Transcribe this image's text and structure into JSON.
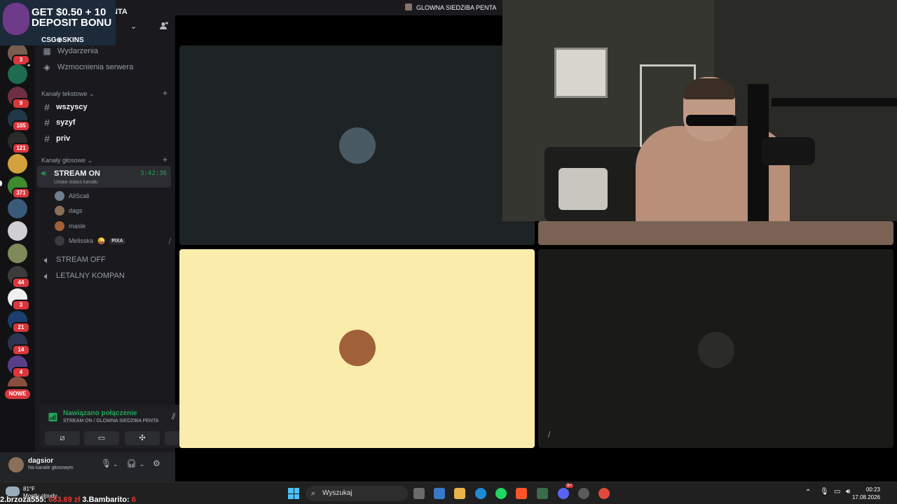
{
  "promo": {
    "headline_line1": "GET $0.50 + 10",
    "headline_line2": "DEPOSIT BONU",
    "brand": "CSG⊕SKINS"
  },
  "server": {
    "name_partial": "NTA"
  },
  "server_rail": {
    "badges": [
      "3",
      "9",
      "105",
      "121",
      "371",
      "44",
      "3",
      "21",
      "14",
      "4"
    ],
    "nowe_label": "NOWE"
  },
  "sidebar": {
    "menu": [
      {
        "label": "Wydarzenia",
        "icon": "calendar-icon"
      },
      {
        "label": "Wzmocnienia serwera",
        "icon": "boost-icon"
      }
    ],
    "text_category": "Kanały tekstowe",
    "text_channels": [
      "wszyscy",
      "syzyf",
      "priv"
    ],
    "voice_category": "Kanały głosowe",
    "active_voice": {
      "name": "STREAM ON",
      "timer": "3:42:36",
      "status": "Ustaw status kanału"
    },
    "members": [
      {
        "name": "AliScali"
      },
      {
        "name": "dags"
      },
      {
        "name": "masle"
      },
      {
        "name": "Melisska",
        "tag": "PIXA"
      }
    ],
    "voice_channels": [
      "STREAM OFF",
      "LETALNY KOMPAN"
    ]
  },
  "voice_panel": {
    "title": "Nawiązano połączenie",
    "subtitle": "STREAM ON / GLOWNA SIEDZIBA PENTA"
  },
  "user_panel": {
    "username": "dagsior",
    "status": "Na kanale głosowym"
  },
  "topbar": {
    "title": "GLOWNA SIEDZIBA PENTA"
  },
  "taskbar": {
    "search_label": "Wyszukaj",
    "weather_temp": "81°F",
    "weather_desc": "Mostly cloudy",
    "time": "00:23",
    "date": "17.08.2026",
    "chat_badge": "9+"
  },
  "ticker": {
    "first": "2.brzoza555:",
    "first_value": "683.69 zł",
    "second": "3.Bambarito:",
    "second_value": "6"
  },
  "colors": {
    "green": "#23a55a",
    "red": "#da373c",
    "sidebar": "#1a1a1e",
    "rail": "#121214",
    "tile_yellow": "#faecaa"
  }
}
